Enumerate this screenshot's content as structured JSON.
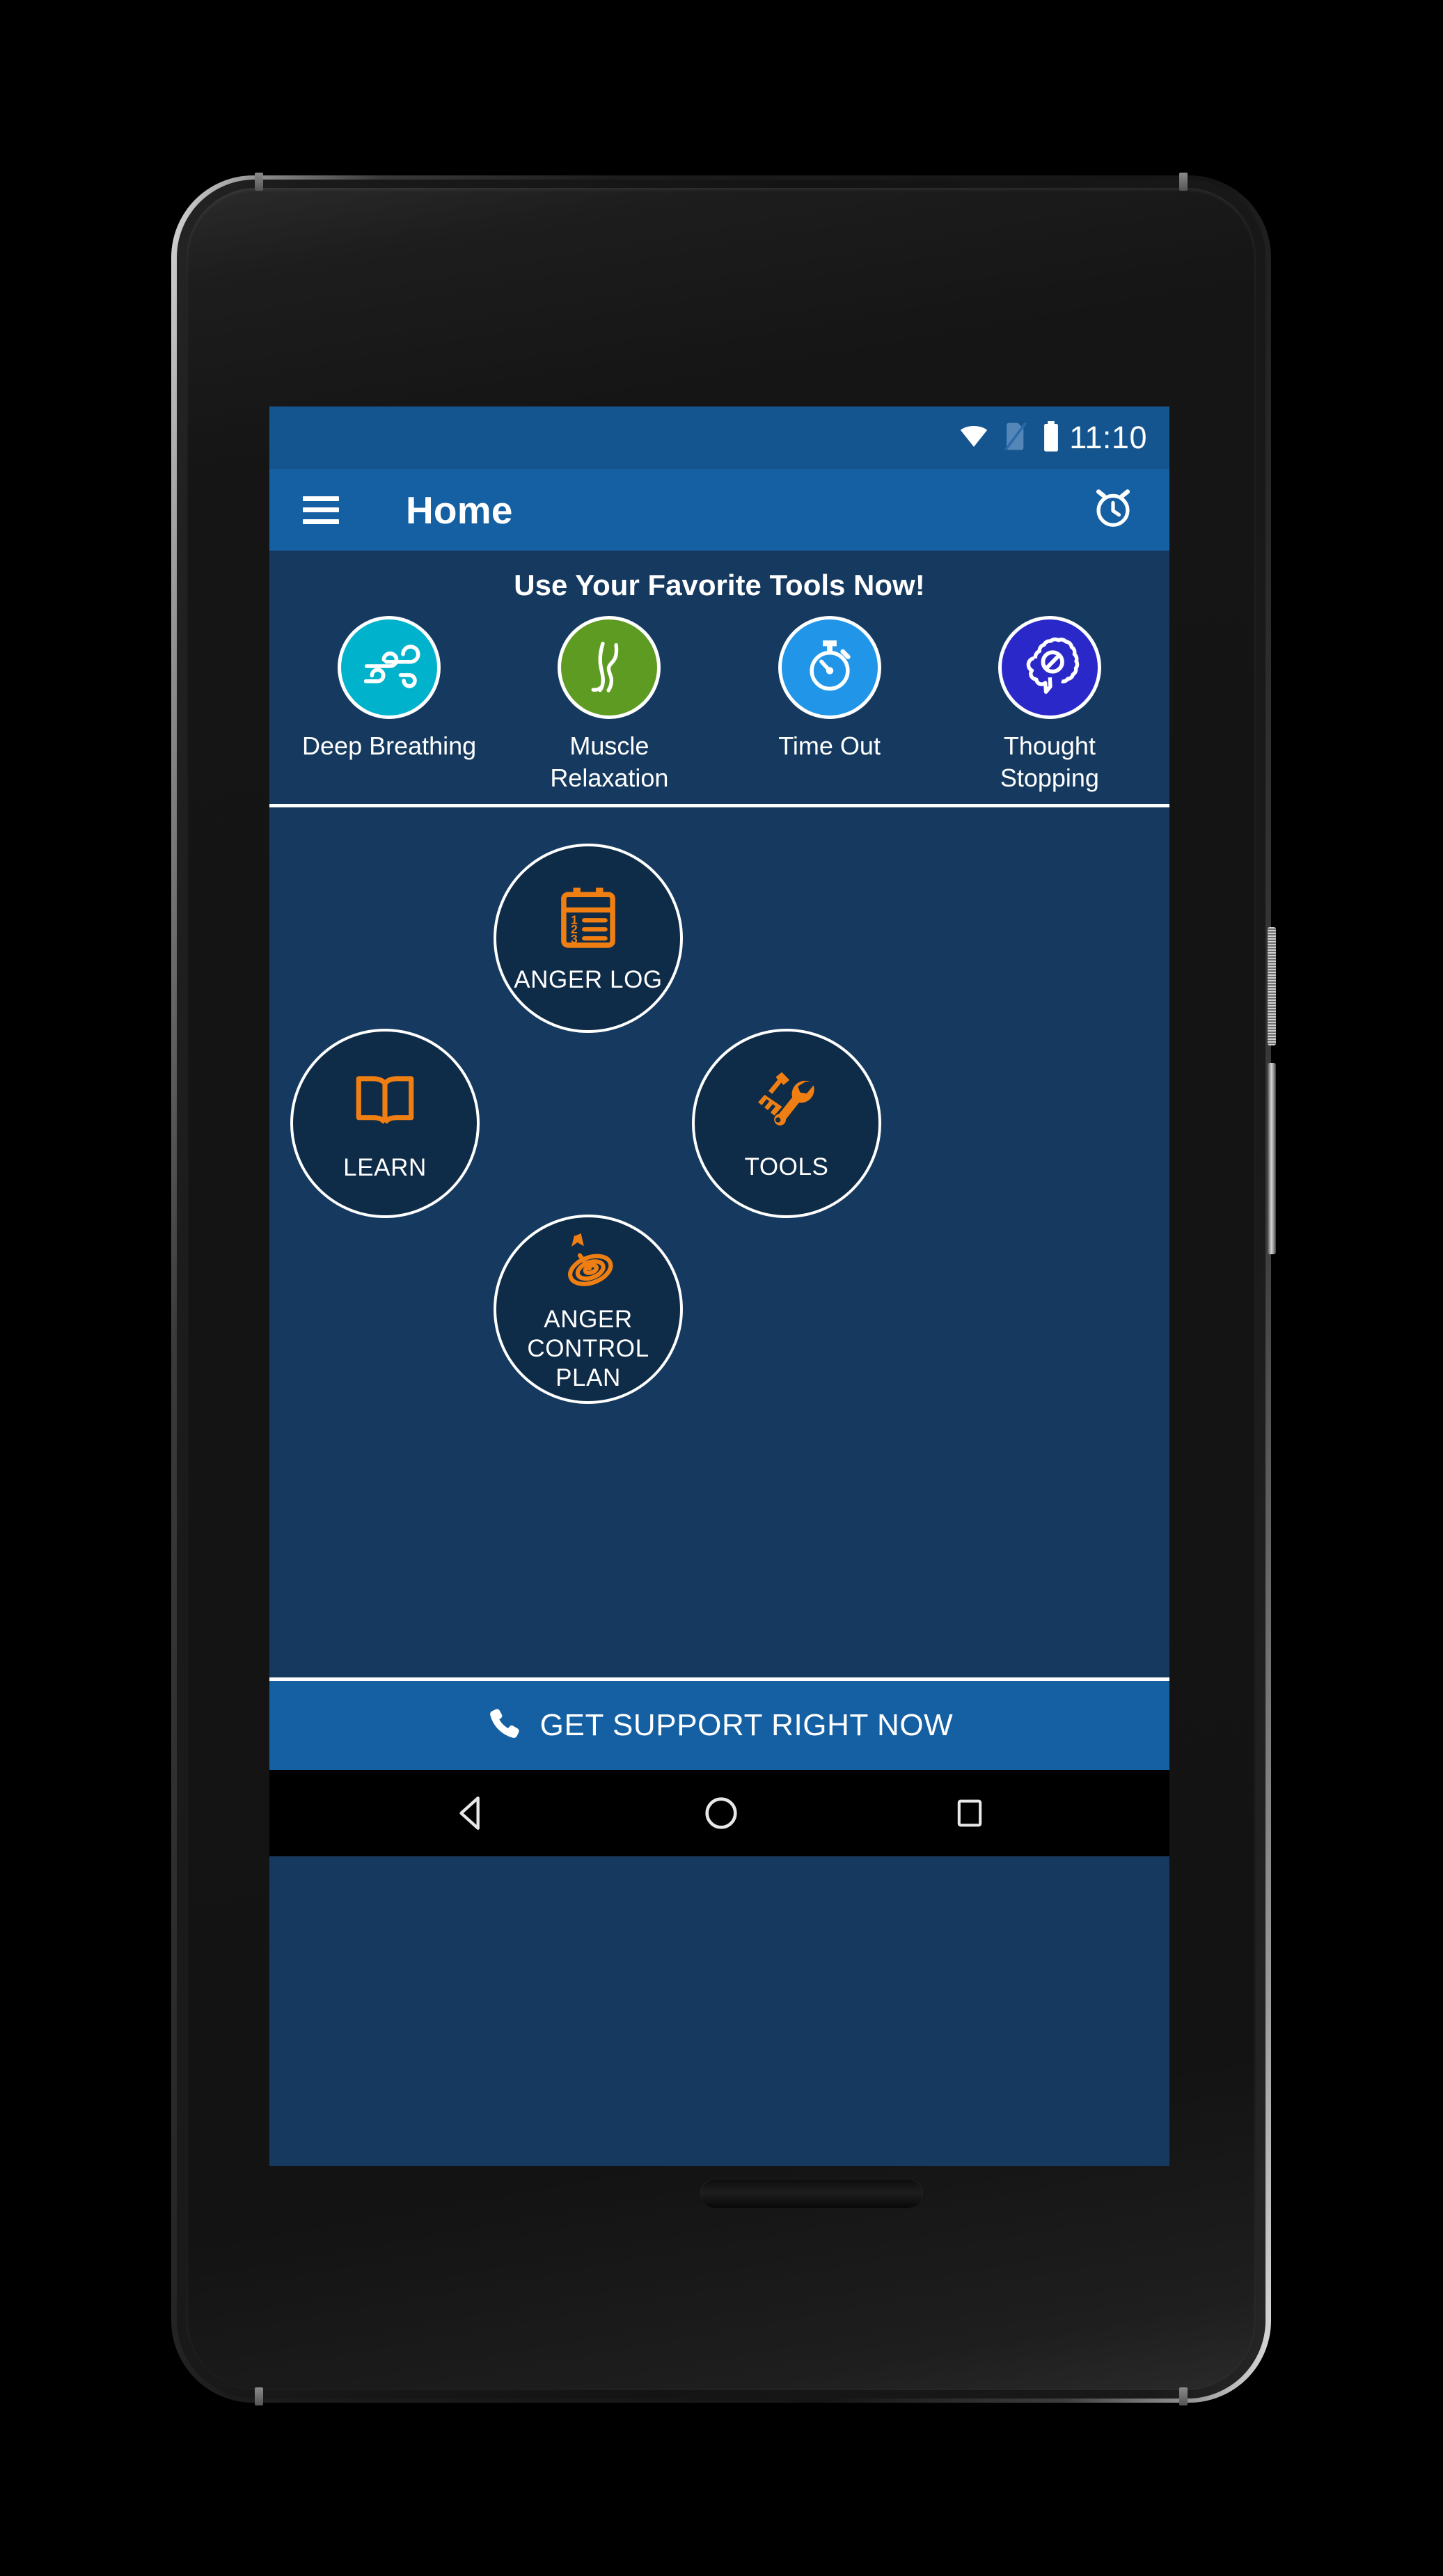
{
  "status_bar": {
    "clock": "11:10",
    "icons": [
      "wifi-icon",
      "no-sim-icon",
      "battery-full-icon"
    ]
  },
  "app_bar": {
    "menu_icon": "hamburger-menu-icon",
    "title": "Home",
    "action_icon": "alarm-clock-icon"
  },
  "favorites": {
    "title": "Use Your Favorite Tools Now!",
    "items": [
      {
        "label": "Deep Breathing",
        "icon": "wind-icon",
        "color": "#00B2CC"
      },
      {
        "label": "Muscle\nRelaxation",
        "icon": "leg-icon",
        "color": "#5E9B22"
      },
      {
        "label": "Time Out",
        "icon": "stopwatch-icon",
        "color": "#2196E8"
      },
      {
        "label": "Thought\nStopping",
        "icon": "brain-stop-icon",
        "color": "#2A28C8"
      }
    ]
  },
  "main_nav": {
    "items": [
      {
        "label": "ANGER LOG",
        "icon": "clipboard-list-icon"
      },
      {
        "label": "LEARN",
        "icon": "open-book-icon"
      },
      {
        "label": "TOOLS",
        "icon": "screwdriver-wrench-icon"
      },
      {
        "label": "ANGER CONTROL PLAN",
        "icon": "spiral-target-dart-icon"
      }
    ]
  },
  "support_bar": {
    "label": "GET SUPPORT RIGHT NOW",
    "icon": "phone-icon"
  },
  "android_nav": {
    "back": "back-triangle-icon",
    "home": "home-circle-icon",
    "recents": "recents-square-icon"
  },
  "theme": {
    "app_bar": "#1560A3",
    "status_bar": "#14558F",
    "content_bg": "#163A5F",
    "circle_bg": "#0E2B47",
    "accent_orange": "#F07F13",
    "text_white": "#FFFFFF"
  }
}
